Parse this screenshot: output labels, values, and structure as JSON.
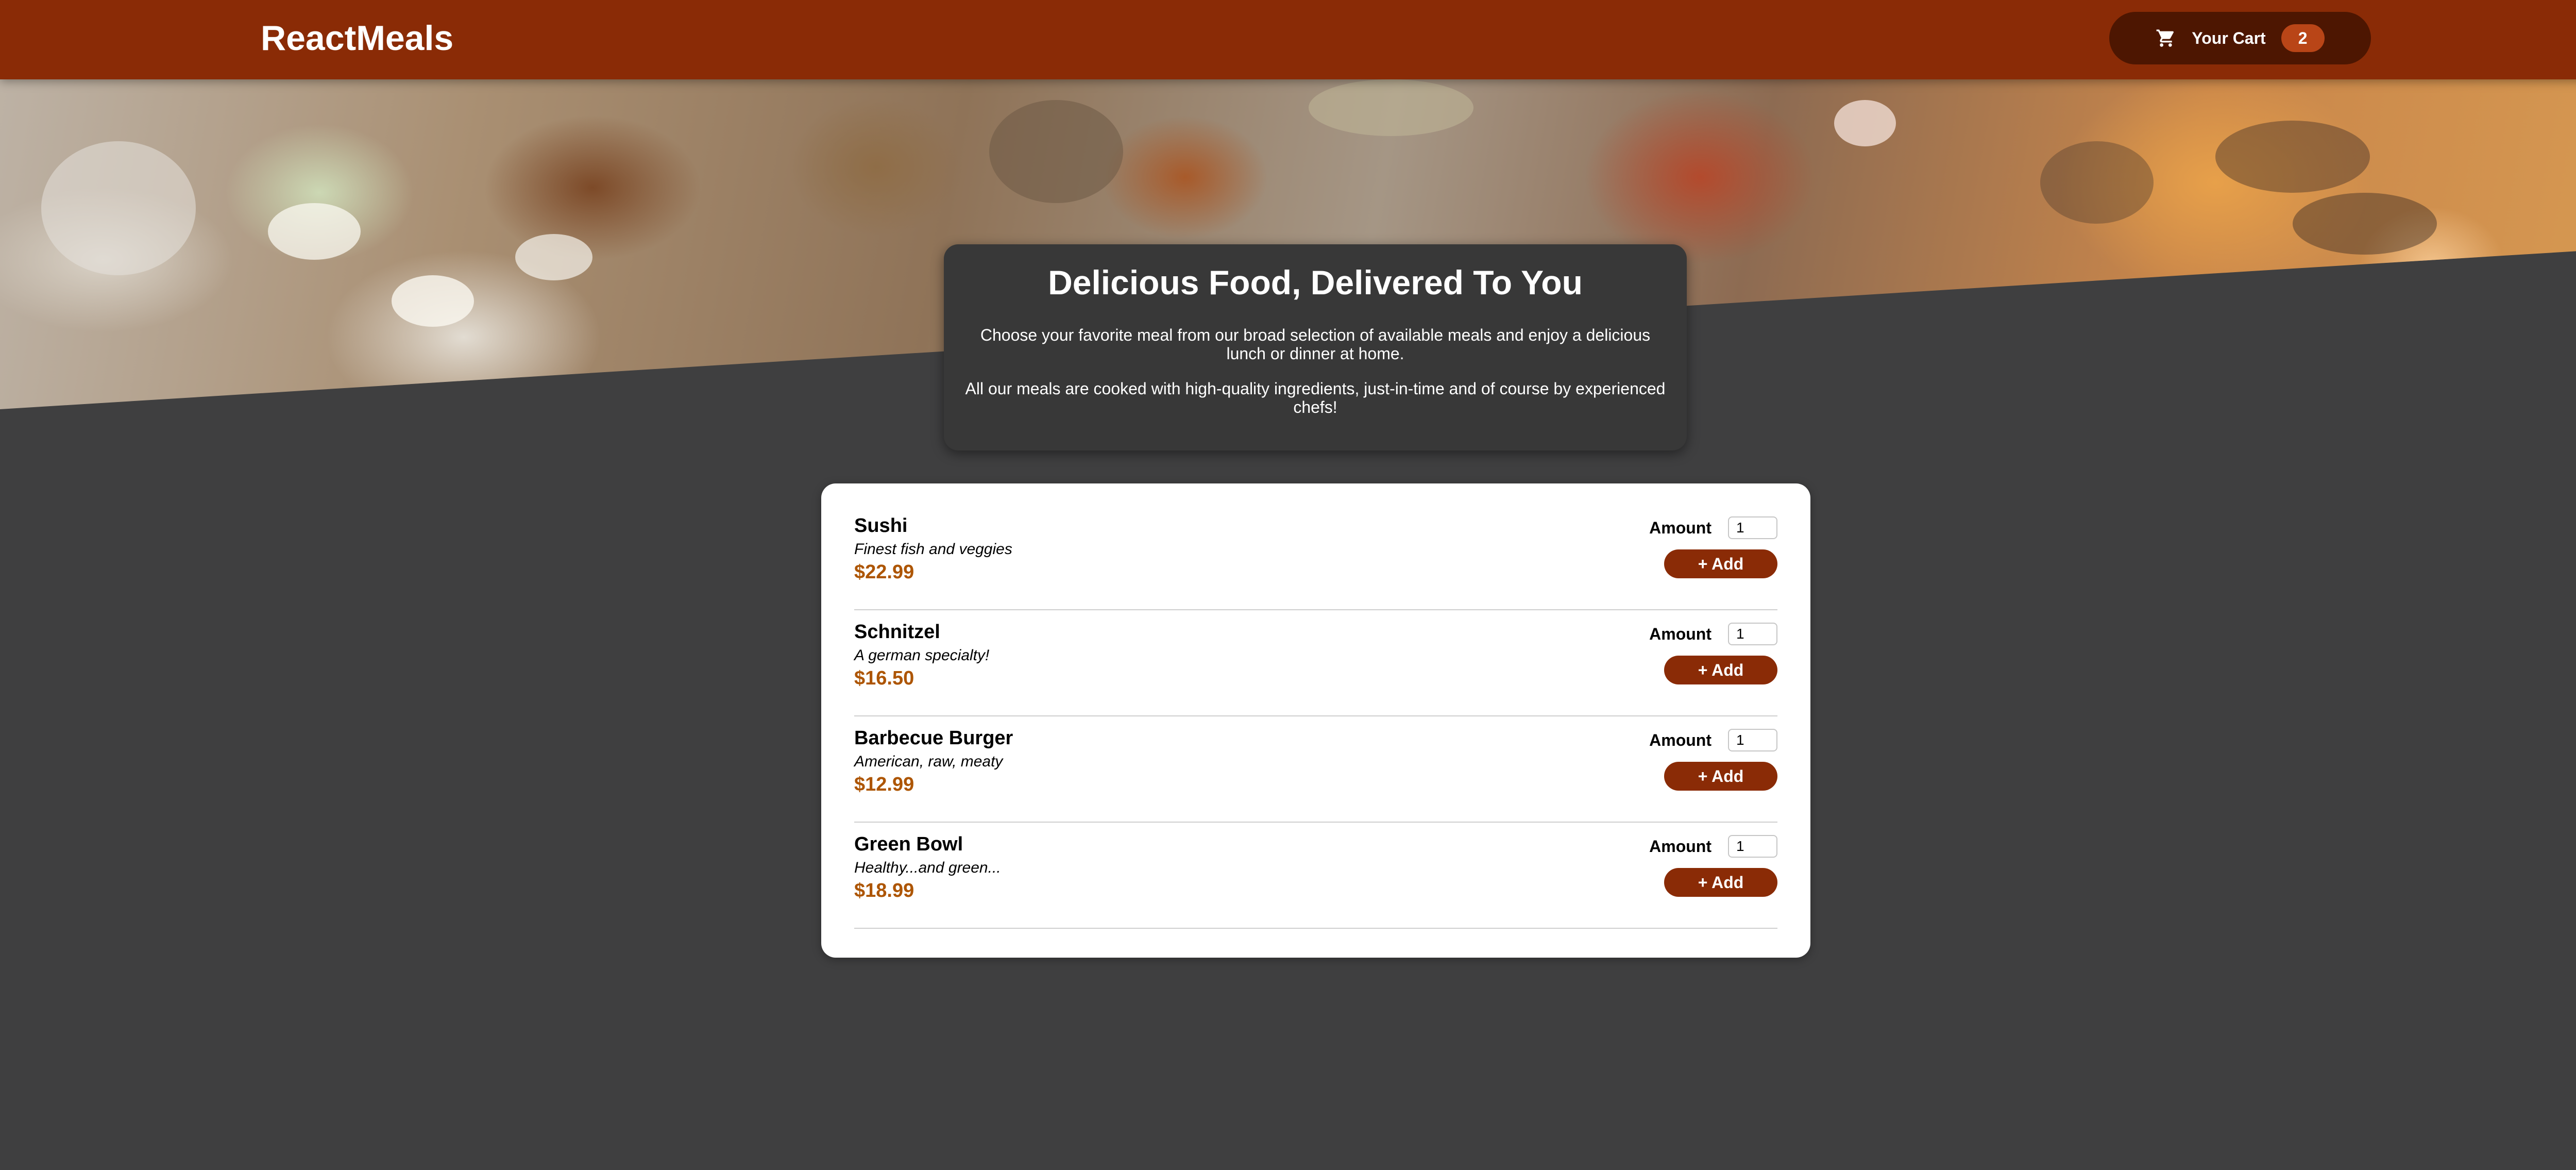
{
  "header": {
    "brand": "ReactMeals",
    "cart": {
      "label": "Your Cart",
      "count": "2",
      "icon": "cart-icon"
    }
  },
  "summary": {
    "title": "Delicious Food, Delivered To You",
    "paragraph_1": "Choose your favorite meal from our broad selection of available meals and enjoy a delicious lunch or dinner at home.",
    "paragraph_2": "All our meals are cooked with high-quality ingredients, just-in-time and of course by experienced chefs!"
  },
  "meals": {
    "amount_label": "Amount",
    "add_label": "+ Add",
    "items": [
      {
        "name": "Sushi",
        "description": "Finest fish and veggies",
        "price": "$22.99",
        "amount": "1"
      },
      {
        "name": "Schnitzel",
        "description": "A german specialty!",
        "price": "$16.50",
        "amount": "1"
      },
      {
        "name": "Barbecue Burger",
        "description": "American, raw, meaty",
        "price": "$12.99",
        "amount": "1"
      },
      {
        "name": "Green Bowl",
        "description": "Healthy...and green...",
        "price": "$18.99",
        "amount": "1"
      }
    ]
  },
  "colors": {
    "header": "#8a2b06",
    "cart_button": "#4d1601",
    "cart_badge": "#b94517",
    "page_background": "#3f3f40",
    "summary_background": "#383838",
    "price": "#ad5502",
    "add_button": "#8a2b06"
  }
}
